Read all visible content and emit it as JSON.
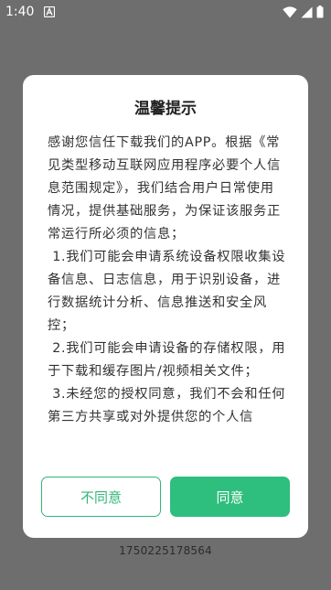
{
  "status_bar": {
    "time": "1:40",
    "app_icon": "a-letter-icon",
    "wifi_icon": "wifi-icon",
    "signal_icon": "cellular-signal-icon",
    "battery_icon": "battery-icon"
  },
  "dialog": {
    "title": "温馨提示",
    "paragraphs": [
      "感谢您信任下载我们的APP。根据《常见类型移动互联网应用程序必要个人信息范围规定》，我们结合用户日常使用情况，提供基础服务，为保证该服务正常运行所必须的信息；",
      " 1.我们可能会申请系统设备权限收集设备信息、日志信息，用于识别设备，进行数据统计分析、信息推送和安全风控；",
      " 2.我们可能会申请设备的存储权限，用于下载和缓存图片/视频相关文件；",
      " 3.未经您的授权同意，我们不会和任何第三方共享或对外提供您的个人信"
    ],
    "decline_label": "不同意",
    "agree_label": "同意"
  },
  "bottom_text": "1750225178564",
  "colors": {
    "overlay_background": "#6e6e6e",
    "accent_green": "#2ebe7d",
    "dialog_background": "#ffffff"
  }
}
